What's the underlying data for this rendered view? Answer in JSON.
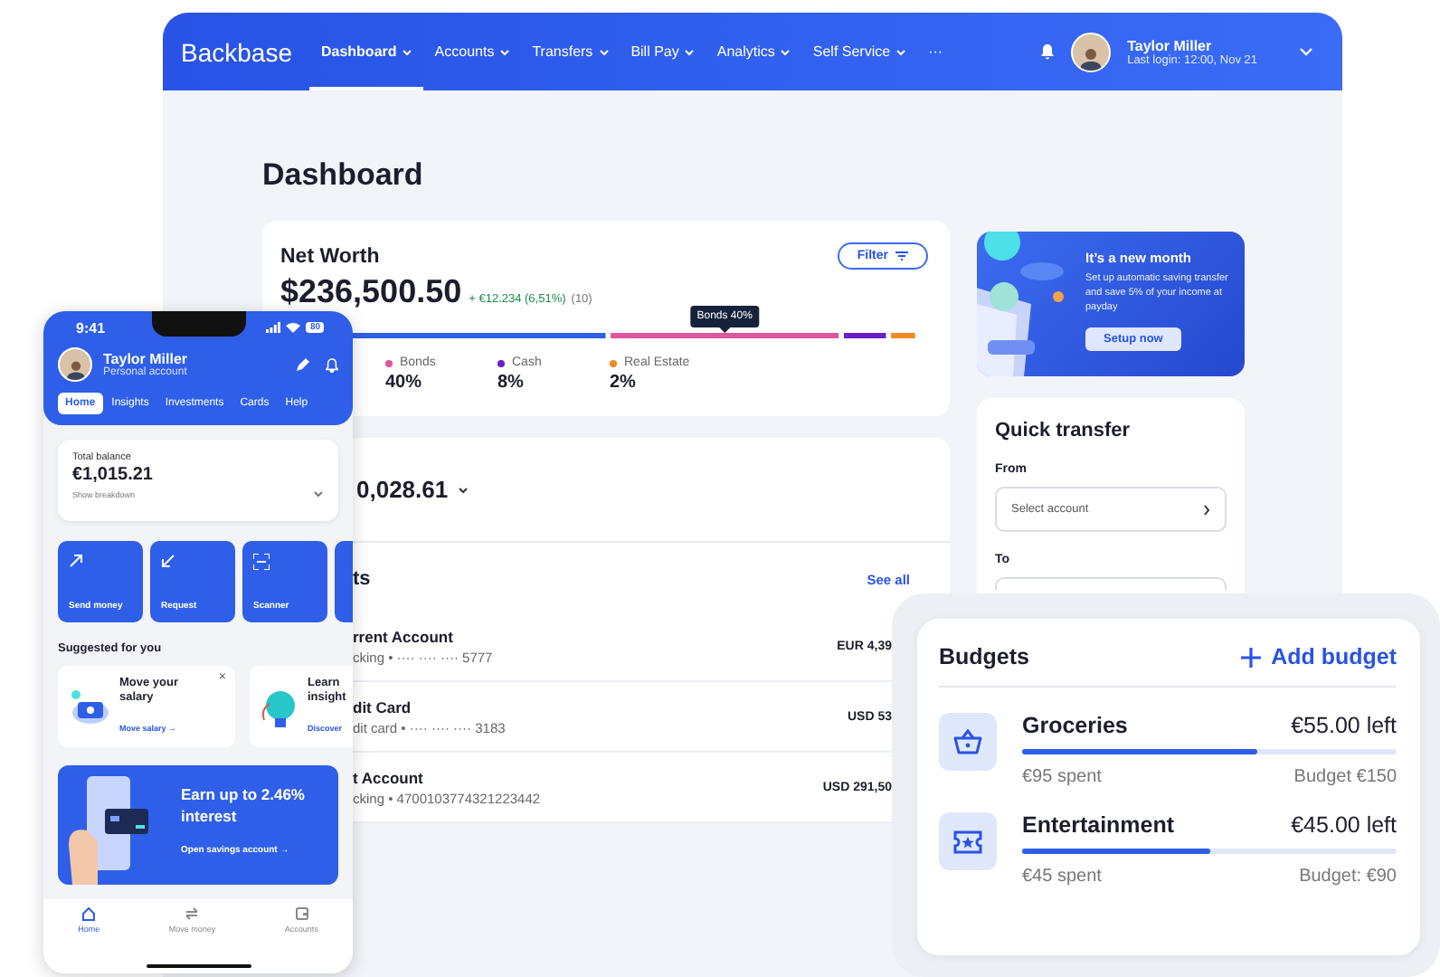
{
  "header": {
    "logo": "Backbase",
    "nav": [
      {
        "label": "Dashboard",
        "selected": true,
        "dropdown": true
      },
      {
        "label": "Accounts",
        "selected": false,
        "dropdown": true
      },
      {
        "label": "Transfers",
        "selected": false,
        "dropdown": true
      },
      {
        "label": "Bill Pay",
        "selected": false,
        "dropdown": true
      },
      {
        "label": "Analytics",
        "selected": false,
        "dropdown": true
      },
      {
        "label": "Self Service",
        "selected": false,
        "dropdown": true
      },
      {
        "label": "···",
        "selected": false,
        "dropdown": false
      }
    ],
    "user": {
      "name": "Taylor Miller",
      "last_login": "Last login: 12:00, Nov 21"
    }
  },
  "page_title": "Dashboard",
  "net_worth": {
    "title": "Net Worth",
    "filter": "Filter",
    "amount": "$236,500.50",
    "change": "+ €12.234 (6,51%)",
    "change_count": "(10)",
    "tooltip": "Bonds 40%",
    "legend": [
      {
        "label": "Bonds",
        "value": "40%",
        "color": "#e0559b"
      },
      {
        "label": "Cash",
        "value": "8%",
        "color": "#6a1fc8"
      },
      {
        "label": "Real Estate",
        "value": "2%",
        "color": "#f5891f"
      }
    ]
  },
  "accounts": {
    "balance": "0,028.61",
    "title": "ts",
    "see_all": "See all",
    "rows": [
      {
        "name": "rrent Account",
        "detail": "cking • ···· ···· ···· 5777",
        "amount": "EUR 4,39"
      },
      {
        "name": "dit Card",
        "detail": "dit card • ···· ···· ···· 3183",
        "amount": "USD 53"
      },
      {
        "name": "t Account",
        "detail": "cking • 4700103774321223442",
        "amount": "USD 291,50"
      }
    ]
  },
  "promo": {
    "title": "It’s a new month",
    "text": "Set up automatic saving transfer and save 5% of your income at payday",
    "button": "Setup now"
  },
  "quick_transfer": {
    "title": "Quick transfer",
    "from_label": "From",
    "from_placeholder": "Select account",
    "to_label": "To"
  },
  "phone": {
    "time": "9:41",
    "battery": "80",
    "user": {
      "name": "Taylor Miller",
      "subtitle": "Personal account"
    },
    "tabs": [
      {
        "label": "Home",
        "selected": true
      },
      {
        "label": "Insights",
        "selected": false
      },
      {
        "label": "Investments",
        "selected": false
      },
      {
        "label": "Cards",
        "selected": false
      },
      {
        "label": "Help",
        "selected": false
      }
    ],
    "balance": {
      "label": "Total balance",
      "amount": "€1,015.21",
      "link": "Show breakdown"
    },
    "actions": [
      "Send money",
      "Request",
      "Scanner"
    ],
    "suggested_title": "Suggested for you",
    "suggestions": [
      {
        "title": "Move your salary",
        "link": "Move salary →",
        "dismiss": "×"
      },
      {
        "title": "Learn insight",
        "link": "Discover"
      }
    ],
    "promo": {
      "title": "Earn up to 2.46% interest",
      "link": "Open savings account →"
    },
    "bottom_nav": [
      {
        "label": "Home",
        "selected": true
      },
      {
        "label": "Move money",
        "selected": false
      },
      {
        "label": "Accounts",
        "selected": false
      }
    ]
  },
  "budgets": {
    "title": "Budgets",
    "add": "Add budget",
    "items": [
      {
        "name": "Groceries",
        "left": "€55.00 left",
        "level": 0.63,
        "spent": "€95 spent",
        "budget": "Budget €150"
      },
      {
        "name": "Entertainment",
        "left": "€45.00 left",
        "level": 0.5,
        "spent": "€45 spent",
        "budget": "Budget: €90"
      }
    ]
  }
}
